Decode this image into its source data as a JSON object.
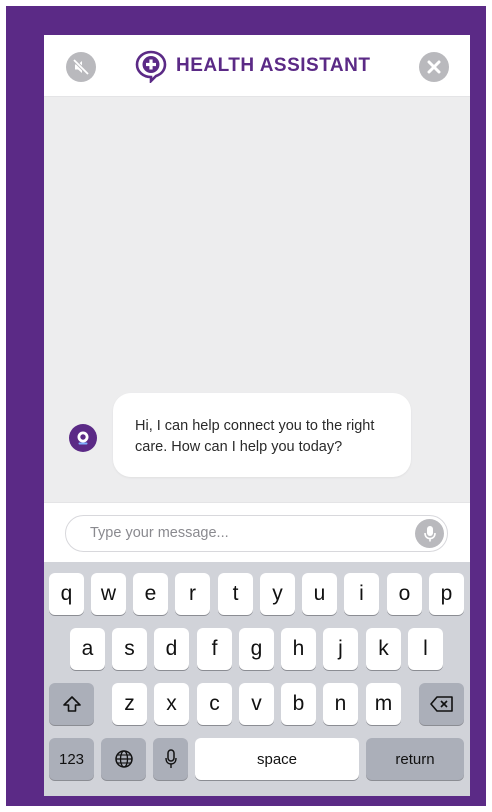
{
  "header": {
    "title": "HEALTH ASSISTANT",
    "mute_icon": "speaker-muted-icon",
    "close_icon": "close-circle-icon",
    "logo_icon": "chat-bubble-plus-icon"
  },
  "chat": {
    "messages": [
      {
        "sender": "assistant",
        "text": "Hi, I can help connect you to the right care. How can I help you today?"
      }
    ]
  },
  "input": {
    "placeholder": "Type your message...",
    "value": "",
    "mic_icon": "microphone-icon"
  },
  "keyboard": {
    "row1": [
      "q",
      "w",
      "e",
      "r",
      "t",
      "y",
      "u",
      "i",
      "o",
      "p"
    ],
    "row2": [
      "a",
      "s",
      "d",
      "f",
      "g",
      "h",
      "j",
      "k",
      "l"
    ],
    "row3": [
      "z",
      "x",
      "c",
      "v",
      "b",
      "n",
      "m"
    ],
    "numbers_label": "123",
    "space_label": "space",
    "return_label": "return",
    "shift_icon": "shift-icon",
    "backspace_icon": "backspace-icon",
    "globe_icon": "globe-icon",
    "dictation_icon": "microphone-icon"
  },
  "colors": {
    "brand": "#5b2a86",
    "icon_gray": "#b9b9bd",
    "chat_background": "#ededee",
    "keyboard_background": "#d1d3d9"
  }
}
